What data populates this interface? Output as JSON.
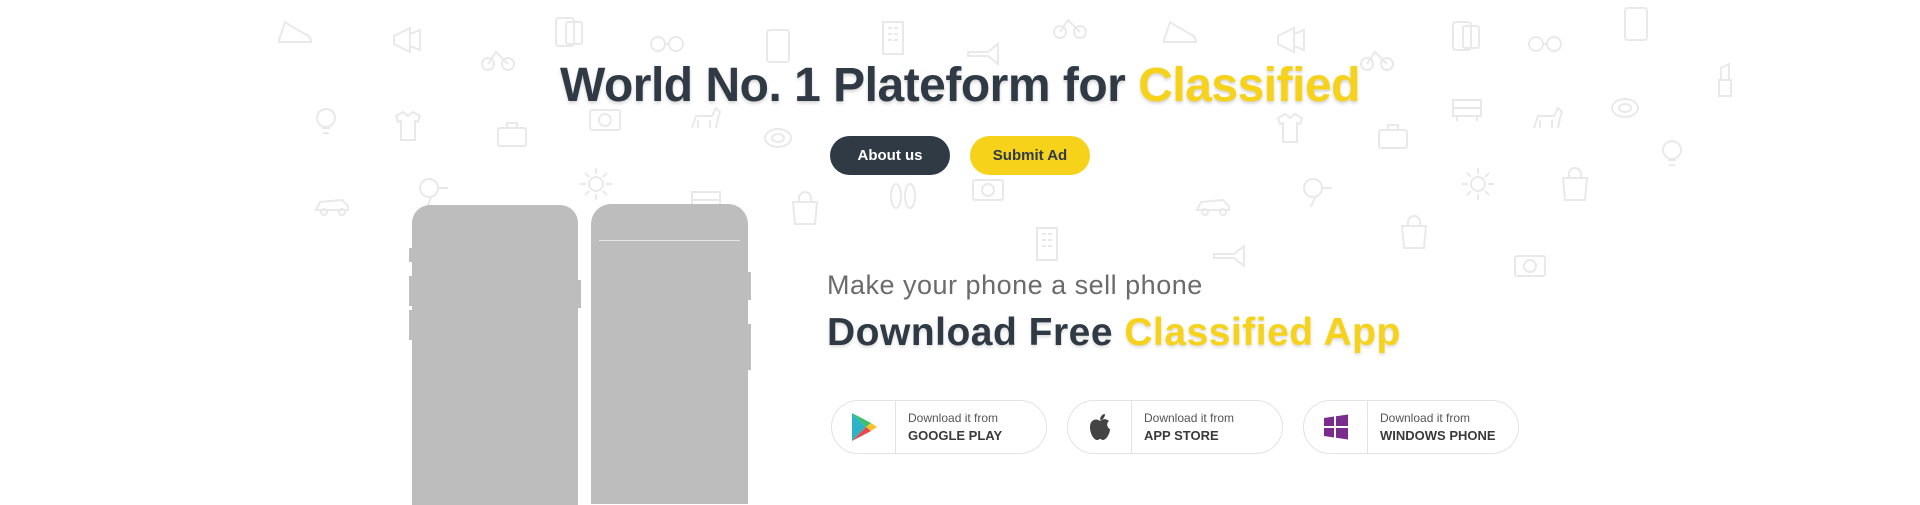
{
  "hero": {
    "title_main": "World No. 1 Plateform for ",
    "title_accent": "Classified",
    "about_label": "About us",
    "submit_label": "Submit Ad"
  },
  "app": {
    "subtitle": "Make your phone a sell phone",
    "title_main": "Download Free ",
    "title_accent": "Classified App"
  },
  "stores": [
    {
      "small": "Download it from",
      "big": "GOOGLE PLAY",
      "icon": "google-play-icon"
    },
    {
      "small": "Download it from",
      "big": "APP STORE",
      "icon": "apple-icon"
    },
    {
      "small": "Download it from",
      "big": "WINDOWS PHONE",
      "icon": "windows-icon"
    }
  ],
  "colors": {
    "dark": "#2f3a44",
    "accent": "#f7d21b",
    "phone_gray": "#bdbdbd",
    "windows_purple": "#7b2a8e"
  },
  "background_icons": [
    "shoe-icon",
    "megaphone-icon",
    "bike-icon",
    "glasses-icon",
    "phone-icon",
    "building-icon",
    "car-icon",
    "lightbulb-icon",
    "tshirt-icon",
    "briefcase-icon",
    "dog-icon",
    "gear-icon",
    "camera-icon",
    "bag-icon",
    "lipstick-icon",
    "sofa-icon",
    "hairdryer-icon",
    "trumpet-icon",
    "slippers-icon"
  ]
}
